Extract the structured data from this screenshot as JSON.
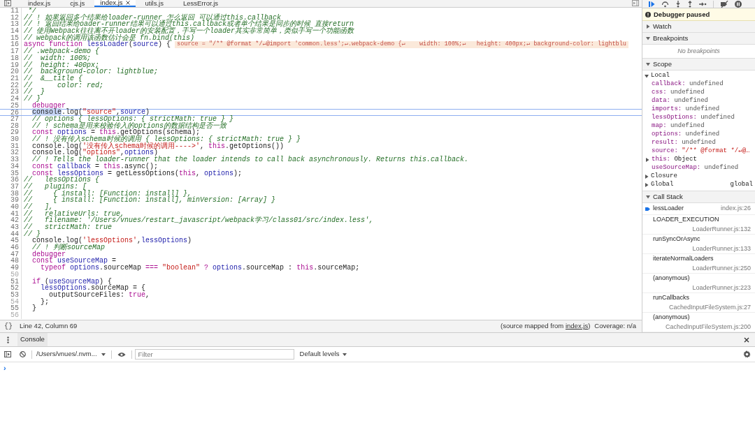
{
  "editor": {
    "tabs": [
      {
        "label": "index.js",
        "selected": false,
        "closable": false
      },
      {
        "label": "cjs.js",
        "selected": false,
        "closable": false
      },
      {
        "label": "index.js",
        "selected": true,
        "closable": true
      },
      {
        "label": "utils.js",
        "selected": false,
        "closable": false
      },
      {
        "label": "LessError.js",
        "selected": false,
        "closable": false
      }
    ],
    "lines": [
      {
        "n": "11",
        "current": false,
        "breakable": true,
        "t": [
          {
            "kind": "c",
            "text": " */"
          }
        ]
      },
      {
        "n": "12",
        "current": false,
        "breakable": true,
        "t": [
          {
            "kind": "c",
            "text": "// ! 如果返回多个结果给loader-runner 怎么返回 可以通过this.callback"
          }
        ]
      },
      {
        "n": "13",
        "current": false,
        "breakable": true,
        "t": [
          {
            "kind": "c",
            "text": "// ! 返回结果给oader-runner结果可以通过this.callback或者单个结果是同步的时候 直接return"
          }
        ]
      },
      {
        "n": "14",
        "current": false,
        "breakable": true,
        "t": [
          {
            "kind": "c",
            "text": "// 使用Webpack往往离不开loader的安装配置，手写一个loader其实非常简单，类似手写一个功能函数"
          }
        ]
      },
      {
        "n": "15",
        "current": false,
        "breakable": true,
        "t": [
          {
            "kind": "c",
            "text": "// webpack的调用该函数估计会是 fn.bind(this)"
          }
        ]
      },
      {
        "n": "16",
        "current": false,
        "breakable": true,
        "t": [
          {
            "kind": "k",
            "text": "async "
          },
          {
            "kind": "k",
            "text": "function "
          },
          {
            "kind": "v",
            "text": "lessLoader"
          },
          {
            "kind": "p",
            "text": "("
          },
          {
            "kind": "v",
            "text": "source"
          },
          {
            "kind": "p",
            "text": ") {"
          }
        ],
        "inline": "source = \"/** @format */↵@import 'common.less';↵.webpack-demo {↵    width: 100%;↵   height: 400px;↵ background-color: lightblu"
      },
      {
        "n": "17",
        "current": false,
        "breakable": true,
        "t": [
          {
            "kind": "c",
            "text": "// .webpack-demo {"
          }
        ]
      },
      {
        "n": "18",
        "current": false,
        "breakable": true,
        "t": [
          {
            "kind": "c",
            "text": "//  width: 100%;"
          }
        ]
      },
      {
        "n": "19",
        "current": false,
        "breakable": true,
        "t": [
          {
            "kind": "c",
            "text": "//  height: 400px;"
          }
        ]
      },
      {
        "n": "20",
        "current": false,
        "breakable": true,
        "t": [
          {
            "kind": "c",
            "text": "//  background-color: lightblue;"
          }
        ]
      },
      {
        "n": "21",
        "current": false,
        "breakable": true,
        "t": [
          {
            "kind": "c",
            "text": "//  &__title {"
          }
        ]
      },
      {
        "n": "22",
        "current": false,
        "breakable": true,
        "t": [
          {
            "kind": "c",
            "text": "//      color: red;"
          }
        ]
      },
      {
        "n": "23",
        "current": false,
        "breakable": true,
        "t": [
          {
            "kind": "c",
            "text": "//  }"
          }
        ]
      },
      {
        "n": "24",
        "current": false,
        "breakable": true,
        "t": [
          {
            "kind": "c",
            "text": "// }"
          }
        ]
      },
      {
        "n": "25",
        "current": false,
        "breakable": true,
        "t": [
          {
            "kind": "k",
            "text": "  debugger"
          }
        ]
      },
      {
        "n": "26",
        "current": true,
        "breakable": true,
        "t": [
          {
            "kind": "sel",
            "text": "  console"
          },
          {
            "kind": "p",
            "text": ".log("
          },
          {
            "kind": "s",
            "text": "\"source\""
          },
          {
            "kind": "p",
            "text": ","
          },
          {
            "kind": "v",
            "text": "source"
          },
          {
            "kind": "p",
            "text": ")"
          }
        ]
      },
      {
        "n": "27",
        "current": false,
        "breakable": true,
        "t": [
          {
            "kind": "c",
            "text": "  // options { lessOptions: { strictMath: true } }"
          }
        ]
      },
      {
        "n": "28",
        "current": false,
        "breakable": true,
        "t": [
          {
            "kind": "c",
            "text": "  // ! schema是用来校验传入的options的数据结构是否一致"
          }
        ]
      },
      {
        "n": "29",
        "current": false,
        "breakable": true,
        "t": [
          {
            "kind": "k",
            "text": "  const "
          },
          {
            "kind": "v",
            "text": "options"
          },
          {
            "kind": "p",
            "text": " = "
          },
          {
            "kind": "k",
            "text": "this"
          },
          {
            "kind": "p",
            "text": ".getOptions(schema);"
          }
        ]
      },
      {
        "n": "30",
        "current": false,
        "breakable": true,
        "t": [
          {
            "kind": "c",
            "text": "  // ! 没有传入schema时候的调用 { lessOptions: { strictMath: true } }"
          }
        ]
      },
      {
        "n": "31",
        "current": false,
        "breakable": true,
        "t": [
          {
            "kind": "p",
            "text": "  console.log("
          },
          {
            "kind": "s",
            "text": "'没有传入schema时候的调用---->'"
          },
          {
            "kind": "p",
            "text": ", "
          },
          {
            "kind": "k",
            "text": "this"
          },
          {
            "kind": "p",
            "text": ".getOptions())"
          }
        ]
      },
      {
        "n": "32",
        "current": false,
        "breakable": true,
        "t": [
          {
            "kind": "p",
            "text": "  console.log("
          },
          {
            "kind": "s",
            "text": "\"options\""
          },
          {
            "kind": "p",
            "text": ","
          },
          {
            "kind": "v",
            "text": "options"
          },
          {
            "kind": "p",
            "text": ")"
          }
        ]
      },
      {
        "n": "33",
        "current": false,
        "breakable": true,
        "t": [
          {
            "kind": "c",
            "text": "  // ! Tells the loader-runner that the loader intends to call back asynchronously. Returns this.callback."
          }
        ]
      },
      {
        "n": "34",
        "current": false,
        "breakable": true,
        "t": [
          {
            "kind": "k",
            "text": "  const "
          },
          {
            "kind": "v",
            "text": "callback"
          },
          {
            "kind": "p",
            "text": " = "
          },
          {
            "kind": "k",
            "text": "this"
          },
          {
            "kind": "p",
            "text": ".async();"
          }
        ]
      },
      {
        "n": "35",
        "current": false,
        "breakable": true,
        "t": [
          {
            "kind": "k",
            "text": "  const "
          },
          {
            "kind": "v",
            "text": "lessOptions"
          },
          {
            "kind": "p",
            "text": " = getLessOptions("
          },
          {
            "kind": "k",
            "text": "this"
          },
          {
            "kind": "p",
            "text": ", "
          },
          {
            "kind": "v",
            "text": "options"
          },
          {
            "kind": "p",
            "text": ");"
          }
        ]
      },
      {
        "n": "36",
        "current": false,
        "breakable": true,
        "t": [
          {
            "kind": "c",
            "text": "//   lessOptions {"
          }
        ]
      },
      {
        "n": "37",
        "current": false,
        "breakable": true,
        "t": [
          {
            "kind": "c",
            "text": "//   plugins: ["
          }
        ]
      },
      {
        "n": "38",
        "current": false,
        "breakable": true,
        "t": [
          {
            "kind": "c",
            "text": "//     { install: [Function: install] },"
          }
        ]
      },
      {
        "n": "39",
        "current": false,
        "breakable": true,
        "t": [
          {
            "kind": "c",
            "text": "//     { install: [Function: install], minVersion: [Array] }"
          }
        ]
      },
      {
        "n": "40",
        "current": false,
        "breakable": true,
        "t": [
          {
            "kind": "c",
            "text": "//   ],"
          }
        ]
      },
      {
        "n": "41",
        "current": false,
        "breakable": true,
        "t": [
          {
            "kind": "c",
            "text": "//   relativeUrls: true,"
          }
        ]
      },
      {
        "n": "42",
        "current": false,
        "breakable": true,
        "t": [
          {
            "kind": "c",
            "text": "//   filename: '/Users/vnues/restart_javascript/webpack学习/class01/src/index.less',"
          }
        ]
      },
      {
        "n": "43",
        "current": false,
        "breakable": true,
        "t": [
          {
            "kind": "c",
            "text": "//   strictMath: true"
          }
        ]
      },
      {
        "n": "44",
        "current": false,
        "breakable": true,
        "t": [
          {
            "kind": "c",
            "text": "// }"
          }
        ]
      },
      {
        "n": "45",
        "current": false,
        "breakable": true,
        "t": [
          {
            "kind": "p",
            "text": "  console.log("
          },
          {
            "kind": "s",
            "text": "'lessOptions'"
          },
          {
            "kind": "p",
            "text": ","
          },
          {
            "kind": "v",
            "text": "lessOptions"
          },
          {
            "kind": "p",
            "text": ")"
          }
        ]
      },
      {
        "n": "46",
        "current": false,
        "breakable": true,
        "t": [
          {
            "kind": "c",
            "text": "  // ! 判断sourceMap"
          }
        ]
      },
      {
        "n": "47",
        "current": false,
        "breakable": true,
        "t": [
          {
            "kind": "k",
            "text": "  debugger"
          }
        ]
      },
      {
        "n": "48",
        "current": false,
        "breakable": true,
        "t": [
          {
            "kind": "k",
            "text": "  const "
          },
          {
            "kind": "v",
            "text": "useSourceMap"
          },
          {
            "kind": "p",
            "text": " ="
          }
        ]
      },
      {
        "n": "49",
        "current": false,
        "breakable": true,
        "t": [
          {
            "kind": "k",
            "text": "    typeof "
          },
          {
            "kind": "v",
            "text": "options"
          },
          {
            "kind": "p",
            "text": ".sourceMap "
          },
          {
            "kind": "k",
            "text": "=== "
          },
          {
            "kind": "s",
            "text": "\"boolean\" "
          },
          {
            "kind": "k",
            "text": "? "
          },
          {
            "kind": "v",
            "text": "options"
          },
          {
            "kind": "p",
            "text": ".sourceMap : "
          },
          {
            "kind": "k",
            "text": "this"
          },
          {
            "kind": "p",
            "text": ".sourceMap;"
          }
        ]
      },
      {
        "n": "50",
        "current": false,
        "breakable": false
      },
      {
        "n": "51",
        "current": false,
        "breakable": true,
        "t": [
          {
            "kind": "k",
            "text": "  if"
          },
          {
            "kind": "p",
            "text": " ("
          },
          {
            "kind": "v",
            "text": "useSourceMap"
          },
          {
            "kind": "p",
            "text": ") {"
          }
        ]
      },
      {
        "n": "52",
        "current": false,
        "breakable": true,
        "t": [
          {
            "kind": "v",
            "text": "    lessOptions"
          },
          {
            "kind": "p",
            "text": ".sourceMap = {"
          }
        ]
      },
      {
        "n": "53",
        "current": false,
        "breakable": true,
        "t": [
          {
            "kind": "p",
            "text": "      outputSourceFiles: "
          },
          {
            "kind": "k",
            "text": "true"
          },
          {
            "kind": "p",
            "text": ","
          }
        ]
      },
      {
        "n": "54",
        "current": false,
        "breakable": false,
        "t": [
          {
            "kind": "p",
            "text": "    };"
          }
        ]
      },
      {
        "n": "55",
        "current": false,
        "breakable": true,
        "t": [
          {
            "kind": "p",
            "text": "  }"
          }
        ]
      },
      {
        "n": "56",
        "current": false,
        "breakable": false
      }
    ]
  },
  "status_bar": {
    "pretty_print": "{}",
    "position": "Line 42, Column 69",
    "source_prefix": "(source mapped from ",
    "source_link": "index.js",
    "source_suffix": ")",
    "coverage": "Coverage: n/a"
  },
  "debugger": {
    "banner": "Debugger paused",
    "watch": {
      "title": "Watch",
      "expanded": false
    },
    "breakpoints": {
      "title": "Breakpoints",
      "expanded": true,
      "empty_text": "No breakpoints"
    },
    "scope": {
      "title": "Scope",
      "expanded": true,
      "groups": [
        {
          "label": "Local",
          "expanded": true,
          "children": [
            {
              "name": "callback:",
              "value": "undefined",
              "kind": "undefined"
            },
            {
              "name": "css:",
              "value": "undefined",
              "kind": "undefined"
            },
            {
              "name": "data:",
              "value": "undefined",
              "kind": "undefined"
            },
            {
              "name": "imports:",
              "value": "undefined",
              "kind": "undefined"
            },
            {
              "name": "lessOptions:",
              "value": "undefined",
              "kind": "undefined"
            },
            {
              "name": "map:",
              "value": "undefined",
              "kind": "undefined"
            },
            {
              "name": "options:",
              "value": "undefined",
              "kind": "undefined"
            },
            {
              "name": "result:",
              "value": "undefined",
              "kind": "undefined"
            },
            {
              "name": "source:",
              "value": "\"/** @format */↵@…",
              "kind": "string"
            },
            {
              "name": "this:",
              "value": "Object",
              "kind": "object",
              "expanded": false
            },
            {
              "name": "useSourceMap:",
              "value": "undefined",
              "kind": "undefined"
            }
          ]
        },
        {
          "label": "Closure",
          "expanded": false
        },
        {
          "label": "Global",
          "expanded": false,
          "value": "global"
        }
      ]
    },
    "call_stack": {
      "title": "Call Stack",
      "expanded": true,
      "frames": [
        {
          "name": "lessLoader",
          "location": "index.js:26",
          "selected": true,
          "kind": "inline"
        },
        {
          "name": "LOADER_EXECUTION",
          "location": "LoaderRunner.js:132",
          "selected": false,
          "kind": "stacked"
        },
        {
          "name": "runSyncOrAsync",
          "location": "LoaderRunner.js:133",
          "selected": false,
          "kind": "stacked"
        },
        {
          "name": "iterateNormalLoaders",
          "location": "LoaderRunner.js:250",
          "selected": false,
          "kind": "stacked"
        },
        {
          "name": "(anonymous)",
          "location": "LoaderRunner.js:223",
          "selected": false,
          "kind": "stacked"
        },
        {
          "name": "runCallbacks",
          "location": "CachedInputFileSystem.js:27",
          "selected": false,
          "kind": "stacked"
        },
        {
          "name": "(anonymous)",
          "location": "CachedInputFileSystem.js:200",
          "selected": false,
          "kind": "stacked"
        }
      ]
    }
  },
  "drawer": {
    "tab": "Console",
    "context": "/Users/vnues/.nvm...",
    "filter_placeholder": "Filter",
    "levels": "Default levels",
    "prompt": "›"
  }
}
